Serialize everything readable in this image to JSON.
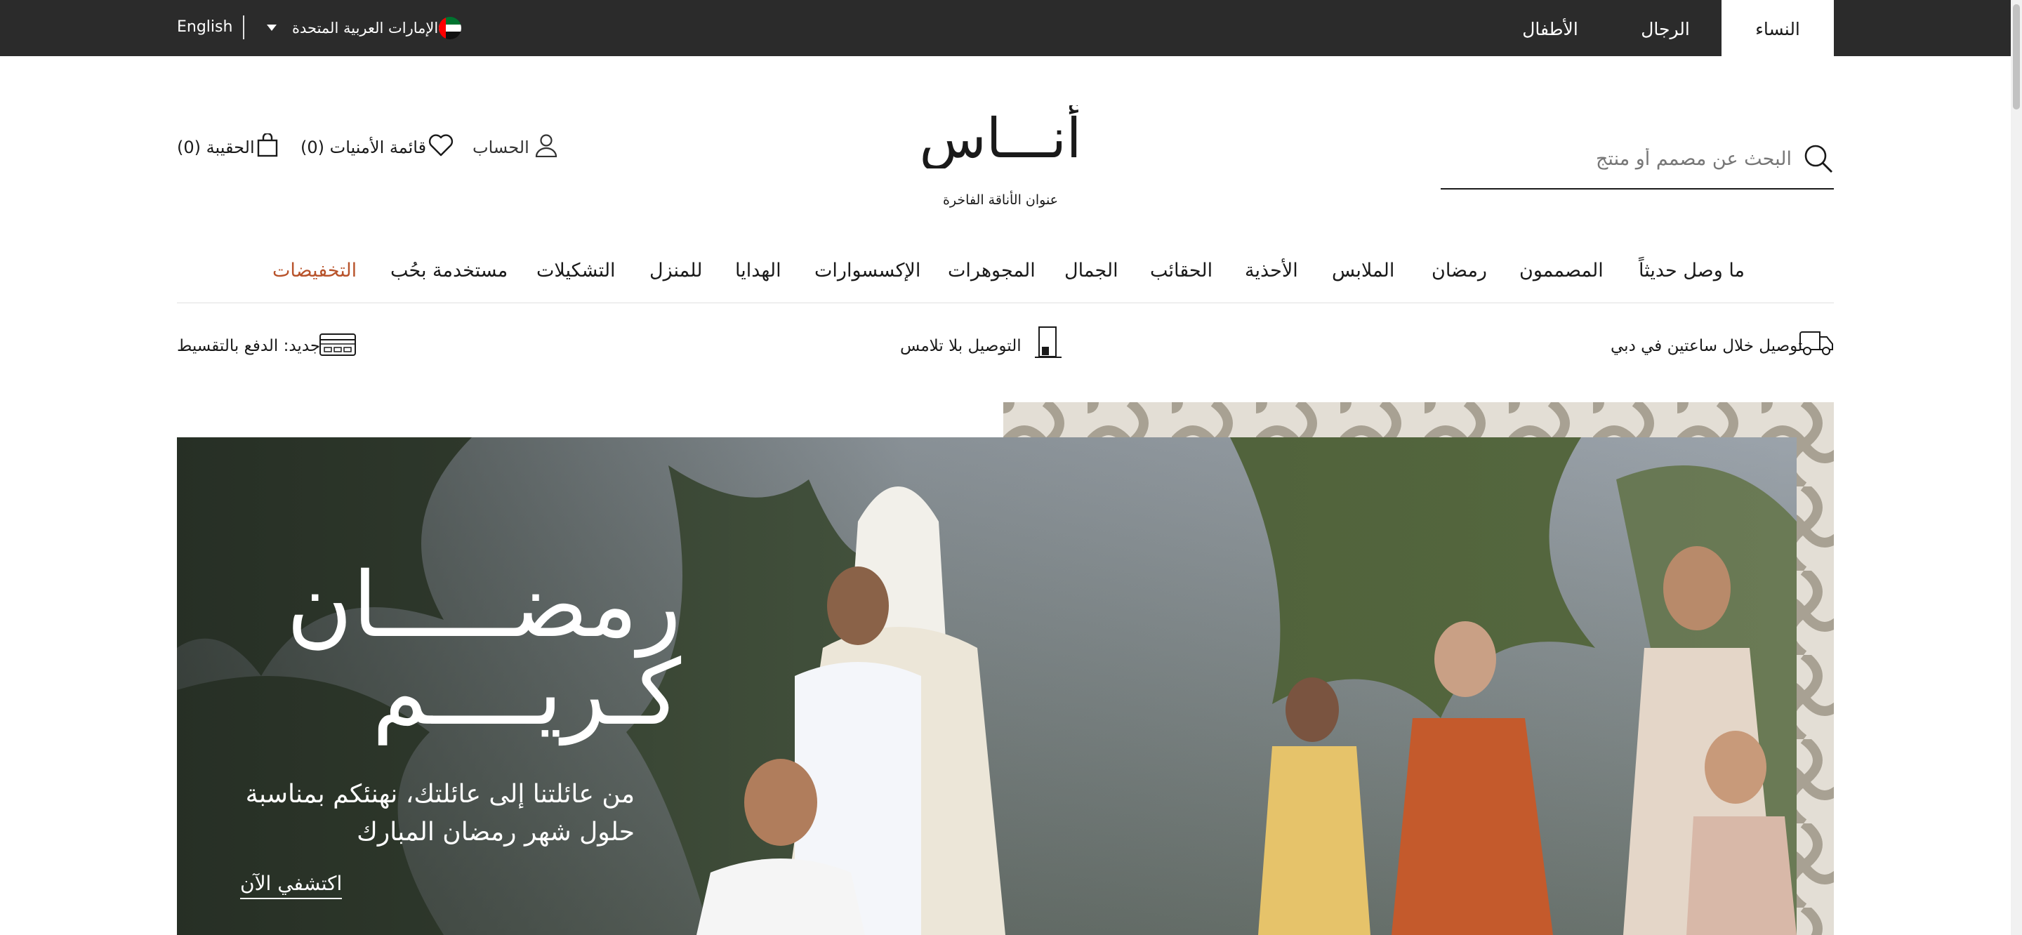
{
  "topbar": {
    "language": "English",
    "country": "الإمارات العربية المتحدة",
    "tabs": {
      "women": "النساء",
      "men": "الرجال",
      "kids": "الأطفال"
    }
  },
  "header": {
    "bag": "الحقيبة (0)",
    "wishlist": "قائمة الأمنيات (0)",
    "account": "الحساب",
    "logo_text": "أنـــاس",
    "tagline": "عنوان الأناقة الفاخرة",
    "search_placeholder": "البحث عن مصمم أو منتج"
  },
  "nav": {
    "new_in": "ما وصل حديثاً",
    "designers": "المصممون",
    "ramadan": "رمضان",
    "clothing": "الملابس",
    "shoes": "الأحذية",
    "bags": "الحقائب",
    "beauty": "الجمال",
    "jewelry": "المجوهرات",
    "accessories": "الإكسسوارات",
    "gifts": "الهدايا",
    "home": "للمنزل",
    "collections": "التشكيلات",
    "preloved": "مستخدمة بحُب",
    "sale": "التخفيضات"
  },
  "benefits": {
    "delivery": "توصيل خلال ساعتين في دبي",
    "contactless": "التوصيل بلا تلامس",
    "installments": "جديد: الدفع بالتقسيط"
  },
  "hero": {
    "title_line1": "رمضـــــان",
    "title_line2": "كـريــــم",
    "subtitle": "من عائلتنا إلى عائلتك، نهنئكم بمناسبة حلول شهر رمضان المبارك",
    "cta": "اكتشفي الآن"
  },
  "colors": {
    "topbar": "#2b2b2b",
    "sale": "#b8532b",
    "text": "#1a1a1a"
  }
}
